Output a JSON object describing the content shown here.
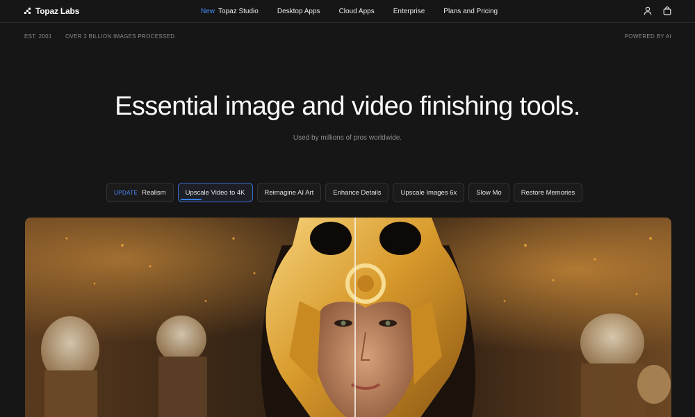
{
  "nav": {
    "brand": "Topaz Labs",
    "links": [
      {
        "badge": "New",
        "label": "Topaz Studio"
      },
      {
        "badge": "",
        "label": "Desktop Apps"
      },
      {
        "badge": "",
        "label": "Cloud Apps"
      },
      {
        "badge": "",
        "label": "Enterprise"
      },
      {
        "badge": "",
        "label": "Plans and Pricing"
      }
    ],
    "icons": [
      "user-icon",
      "shopping-bag-icon"
    ]
  },
  "subbar": {
    "est": "EST. 2001",
    "processed": "OVER 2 BILLION IMAGES PROCESSED",
    "powered": "POWERED BY AI"
  },
  "hero": {
    "title": "Essential image and video finishing tools.",
    "subtitle": "Used by millions of pros worldwide."
  },
  "tabs": [
    {
      "badge": "UPDATE",
      "label": "Realism"
    },
    {
      "badge": "",
      "label": "Upscale Video to 4K",
      "active": true,
      "progress": 0.3
    },
    {
      "badge": "",
      "label": "Reimagine AI Art"
    },
    {
      "badge": "",
      "label": "Enhance Details"
    },
    {
      "badge": "",
      "label": "Upscale Images 6x"
    },
    {
      "badge": "",
      "label": "Slow Mo"
    },
    {
      "badge": "",
      "label": "Restore Memories"
    }
  ],
  "colors": {
    "background": "#161616",
    "accent": "#4a8cff"
  }
}
